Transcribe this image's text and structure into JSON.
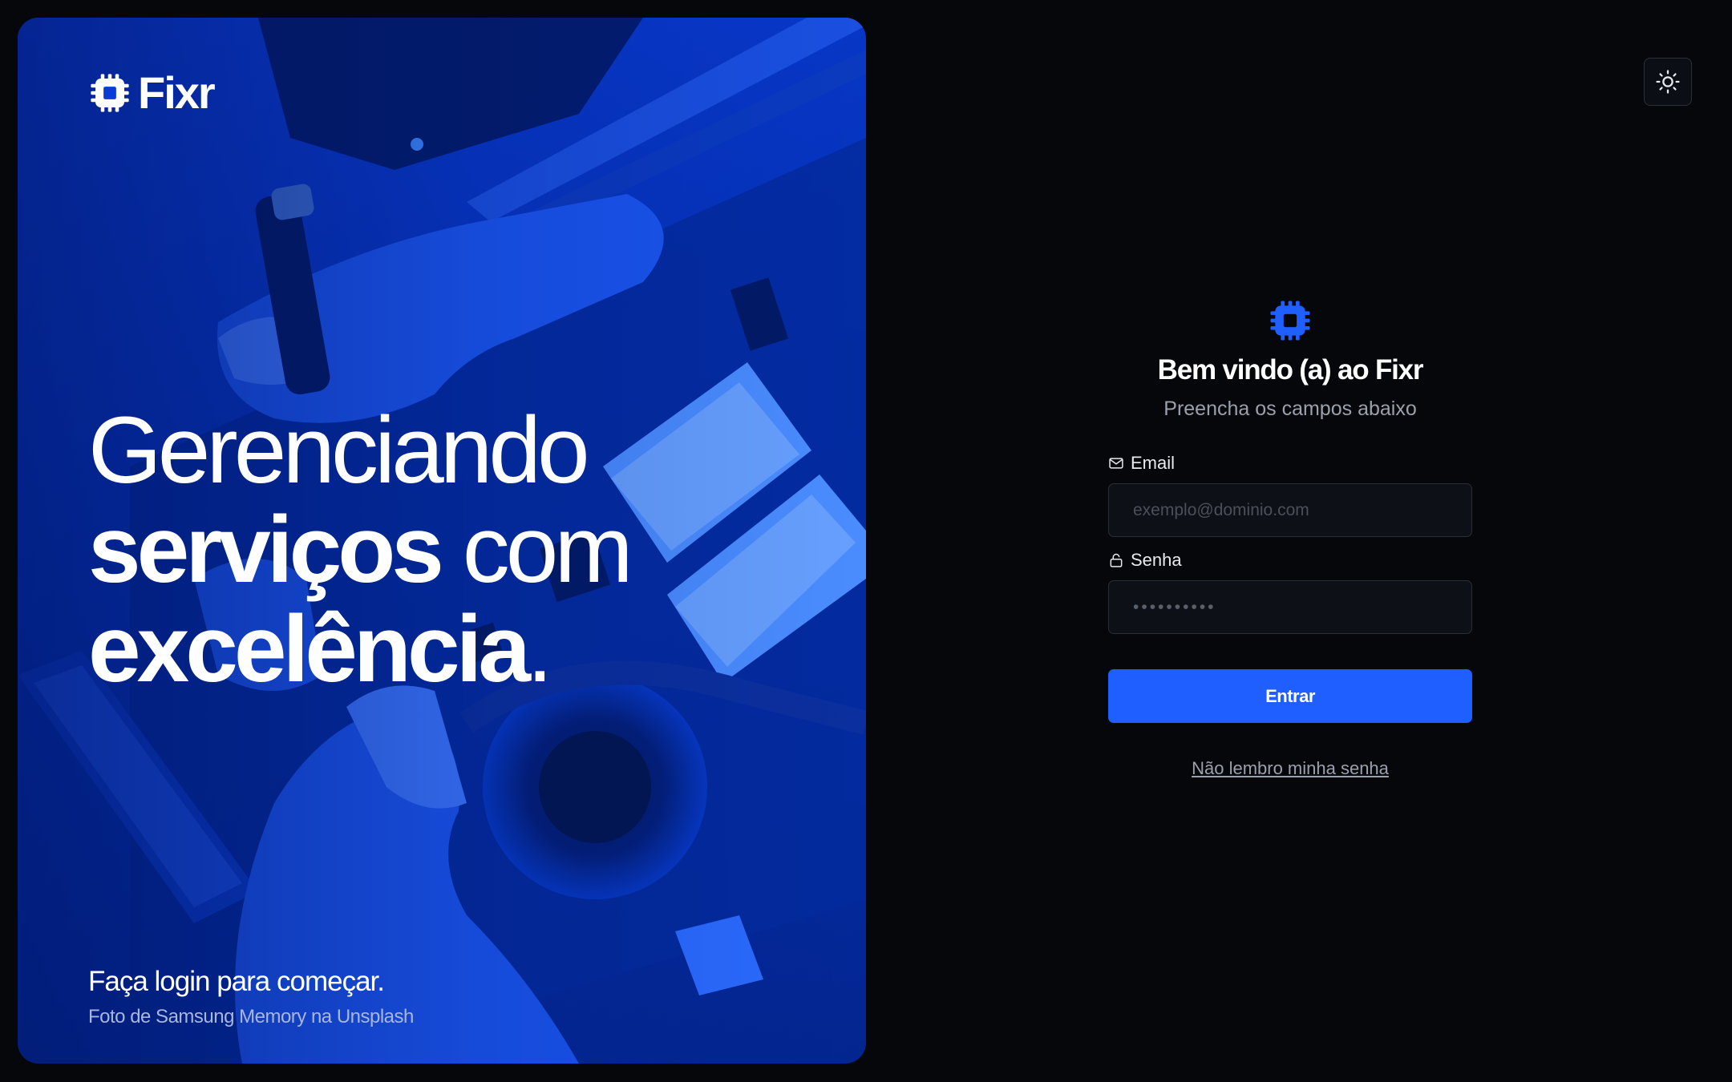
{
  "colors": {
    "accent": "#1f5eff",
    "background": "#05070b",
    "hero_tint": "#0532b8",
    "muted_text": "#9aa0ac"
  },
  "brand": {
    "name": "Fixr",
    "icon": "chip-icon"
  },
  "hero": {
    "headline": {
      "line1": "Gerenciando",
      "line2_bold": "serviços",
      "line2_light": "com",
      "line3_bold": "excelência",
      "line3_light": "."
    },
    "cta": "Faça login para começar.",
    "photo_credit": "Foto de Samsung Memory na Unsplash"
  },
  "theme_toggle": {
    "icon": "sun-icon"
  },
  "login": {
    "logo_icon": "chip-icon",
    "title": "Bem vindo (a) ao Fixr",
    "subtitle": "Preencha os campos abaixo",
    "email": {
      "label": "Email",
      "icon": "mail-icon",
      "placeholder": "exemplo@dominio.com",
      "value": ""
    },
    "password": {
      "label": "Senha",
      "icon": "lock-icon",
      "placeholder": "••••••••••",
      "value": ""
    },
    "submit_label": "Entrar",
    "forgot_label": "Não lembro minha senha"
  }
}
